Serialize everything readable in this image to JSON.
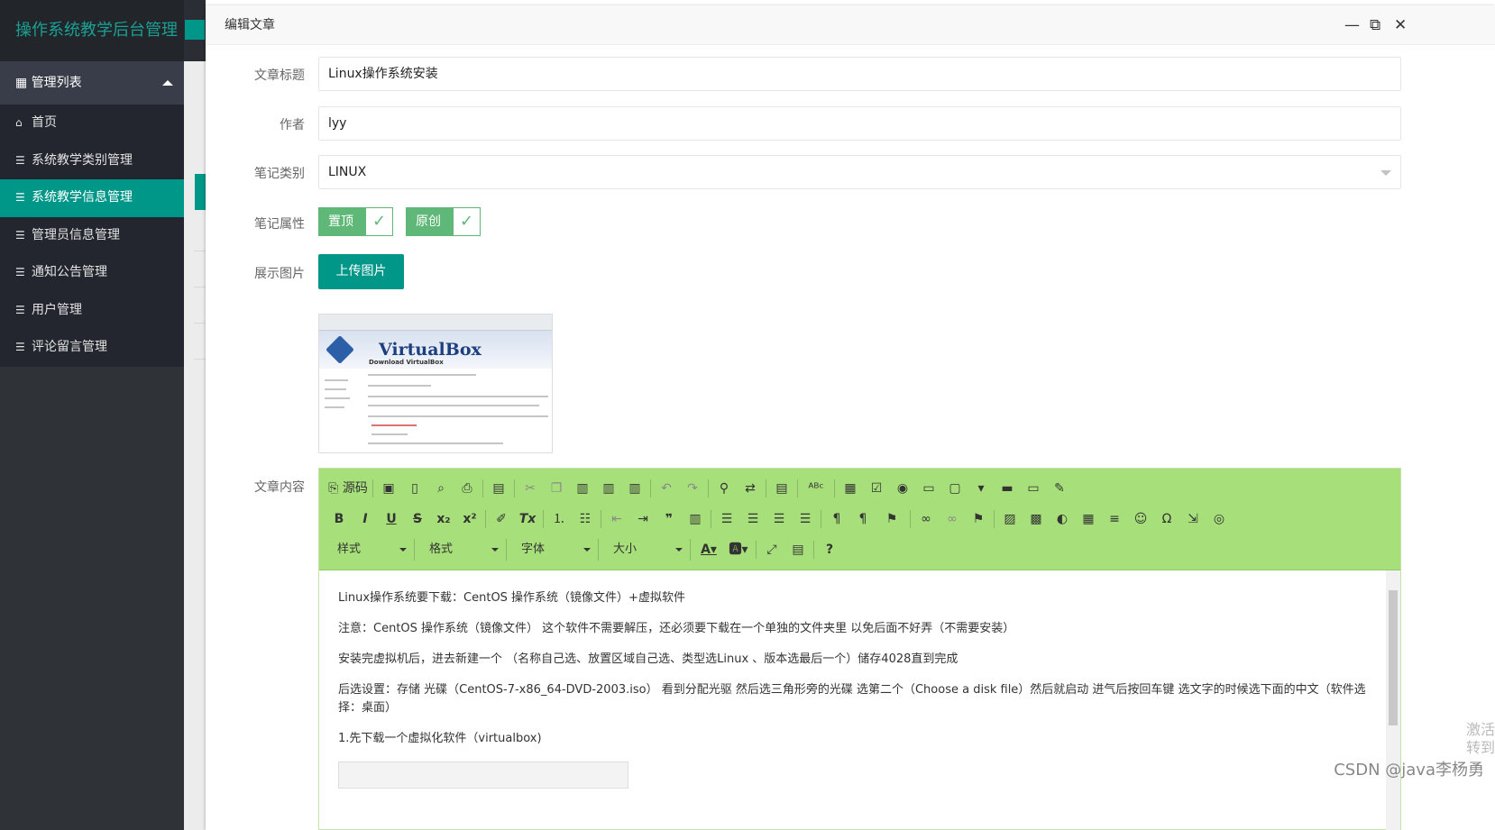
{
  "sidebar": {
    "brand": "操作系统教学后台管理",
    "menu_head": "管理列表",
    "items": [
      {
        "label": "首页"
      },
      {
        "label": "系统教学类别管理"
      },
      {
        "label": "系统教学信息管理"
      },
      {
        "label": "管理员信息管理"
      },
      {
        "label": "通知公告管理"
      },
      {
        "label": "用户管理"
      },
      {
        "label": "评论留言管理"
      }
    ]
  },
  "modal": {
    "title": "编辑文章",
    "fields": {
      "title_label": "文章标题",
      "title_value": "Linux操作系统安装",
      "author_label": "作者",
      "author_value": "lyy",
      "category_label": "笔记类别",
      "category_value": "LINUX",
      "attr_label": "笔记属性",
      "attr_top": "置顶",
      "attr_original": "原创",
      "image_label": "展示图片",
      "upload_button": "上传图片",
      "content_label": "文章内容"
    },
    "preview": {
      "title": "VirtualBox",
      "subtitle": "Download VirtualBox"
    },
    "editor": {
      "source_label": "源码",
      "combo_style": "样式",
      "combo_format": "格式",
      "combo_font": "字体",
      "combo_size": "大小",
      "paragraphs": [
        "Linux操作系统要下载：CentOS 操作系统（镜像文件）+虚拟软件",
        "注意：CentOS 操作系统（镜像文件） 这个软件不需要解压，还必须要下载在一个单独的文件夹里 以免后面不好弄（不需要安装）",
        "安装完虚拟机后，进去新建一个 （名称自己选、放置区域自己选、类型选Linux 、版本选最后一个）储存4028直到完成",
        "后选设置：存储 光碟（CentOS-7-x86_64-DVD-2003.iso） 看到分配光驱 然后选三角形旁的光碟 选第二个（Choose a disk file）然后就启动 进气后按回车键 选文字的时候选下面的中文（软件选择：桌面）",
        "1.先下载一个虚拟化软件（virtualbox)"
      ]
    }
  },
  "watermark": "CSDN @java李杨勇",
  "activate_text": "激活 转到"
}
